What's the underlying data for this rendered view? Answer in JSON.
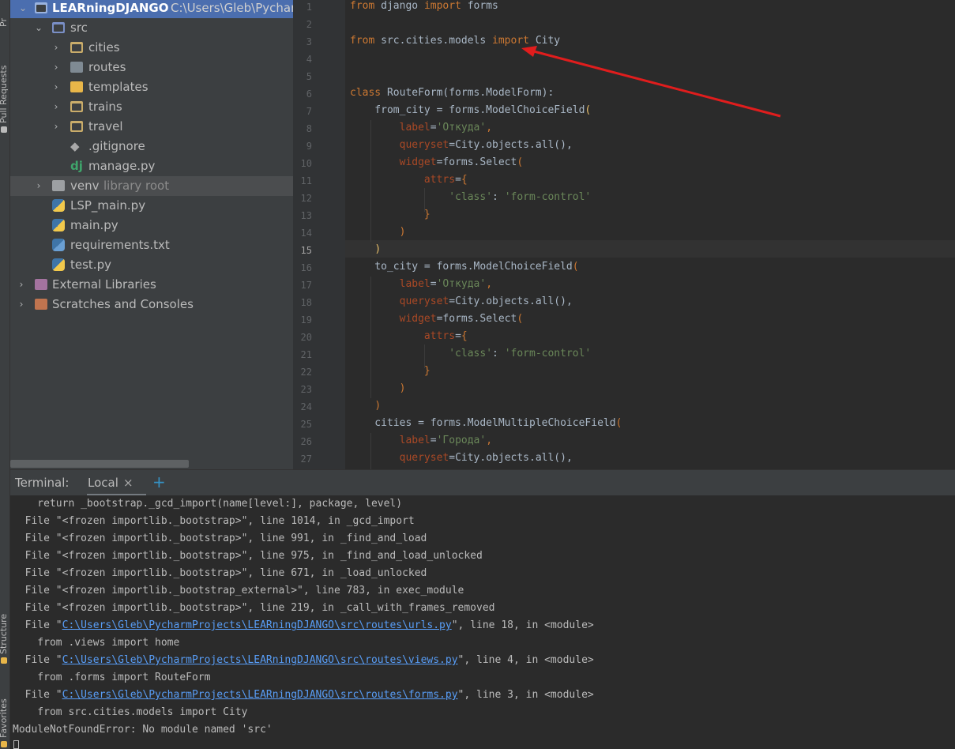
{
  "tool_strip": {
    "top_tab": "Pr",
    "pull_requests_tab": "Pull Requests",
    "structure_tab": "Structure",
    "favorites_tab": "Favorites"
  },
  "project_tree": {
    "root": {
      "name": "LEARningDJANGO",
      "path": "C:\\Users\\Gleb\\Pycharm"
    },
    "items": [
      {
        "label": "src",
        "sub": ""
      },
      {
        "label": "cities",
        "sub": ""
      },
      {
        "label": "routes",
        "sub": ""
      },
      {
        "label": "templates",
        "sub": ""
      },
      {
        "label": "trains",
        "sub": ""
      },
      {
        "label": "travel",
        "sub": ""
      },
      {
        "label": ".gitignore",
        "sub": ""
      },
      {
        "label": "manage.py",
        "sub": ""
      },
      {
        "label": "venv",
        "sub": "library root"
      },
      {
        "label": "LSP_main.py",
        "sub": ""
      },
      {
        "label": "main.py",
        "sub": ""
      },
      {
        "label": "requirements.txt",
        "sub": ""
      },
      {
        "label": "test.py",
        "sub": ""
      },
      {
        "label": "External Libraries",
        "sub": ""
      },
      {
        "label": "Scratches and Consoles",
        "sub": ""
      }
    ]
  },
  "editor": {
    "current_line": 15,
    "line_numbers": [
      "1",
      "2",
      "3",
      "4",
      "5",
      "6",
      "7",
      "8",
      "9",
      "10",
      "11",
      "12",
      "13",
      "14",
      "15",
      "16",
      "17",
      "18",
      "19",
      "20",
      "21",
      "22",
      "23",
      "24",
      "25",
      "26",
      "27"
    ],
    "code": {
      "l1": [
        "from",
        " django ",
        "import",
        " forms"
      ],
      "l3": [
        "from",
        " src.cities.models ",
        "import",
        " City"
      ],
      "l6": [
        "class",
        " RouteForm(forms.ModelForm):"
      ],
      "l7": [
        "    from_city = forms.ModelChoiceField",
        "("
      ],
      "l8": [
        "        ",
        "label",
        "=",
        "'Откуда'",
        ","
      ],
      "l9": [
        "        ",
        "queryset",
        "=City.objects.all(),"
      ],
      "l10": [
        "        ",
        "widget",
        "=forms.Select",
        "("
      ],
      "l11": [
        "            ",
        "attrs",
        "=",
        "{"
      ],
      "l12": [
        "                ",
        "'class'",
        ": ",
        "'form-control'"
      ],
      "l13": [
        "            ",
        "}"
      ],
      "l14": [
        "        ",
        ")"
      ],
      "l15": [
        "    ",
        ")"
      ],
      "l16": [
        "    to_city = forms.ModelChoiceField",
        "("
      ],
      "l17": [
        "        ",
        "label",
        "=",
        "'Откуда'",
        ","
      ],
      "l18": [
        "        ",
        "queryset",
        "=City.objects.all(),"
      ],
      "l19": [
        "        ",
        "widget",
        "=forms.Select",
        "("
      ],
      "l20": [
        "            ",
        "attrs",
        "=",
        "{"
      ],
      "l21": [
        "                ",
        "'class'",
        ": ",
        "'form-control'"
      ],
      "l22": [
        "            ",
        "}"
      ],
      "l23": [
        "        ",
        ")"
      ],
      "l24": [
        "    ",
        ")"
      ],
      "l25": [
        "    cities = forms.ModelMultipleChoiceField",
        "("
      ],
      "l26": [
        "        ",
        "label",
        "=",
        "'Города'",
        ","
      ],
      "l27": [
        "        ",
        "queryset",
        "=City.objects.all(),"
      ]
    }
  },
  "terminal": {
    "title": "Terminal:",
    "tab_label": "Local",
    "close_glyph": "×",
    "add_glyph": "+",
    "lines": [
      "    return _bootstrap._gcd_import(name[level:], package, level)",
      "  File \"<frozen importlib._bootstrap>\", line 1014, in _gcd_import",
      "  File \"<frozen importlib._bootstrap>\", line 991, in _find_and_load",
      "  File \"<frozen importlib._bootstrap>\", line 975, in _find_and_load_unlocked",
      "  File \"<frozen importlib._bootstrap>\", line 671, in _load_unlocked",
      "  File \"<frozen importlib._bootstrap_external>\", line 783, in exec_module",
      "  File \"<frozen importlib._bootstrap>\", line 219, in _call_with_frames_removed"
    ],
    "link_lines": [
      {
        "pre": "  File \"",
        "link": "C:\\Users\\Gleb\\PycharmProjects\\LEARningDJANGO\\src\\routes\\urls.py",
        "post": "\", line 18, in <module>"
      },
      {
        "text": "    from .views import home"
      },
      {
        "pre": "  File \"",
        "link": "C:\\Users\\Gleb\\PycharmProjects\\LEARningDJANGO\\src\\routes\\views.py",
        "post": "\", line 4, in <module>"
      },
      {
        "text": "    from .forms import RouteForm"
      },
      {
        "pre": "  File \"",
        "link": "C:\\Users\\Gleb\\PycharmProjects\\LEARningDJANGO\\src\\routes\\forms.py",
        "post": "\", line 3, in <module>"
      },
      {
        "text": "    from src.cities.models import City"
      }
    ],
    "error": "ModuleNotFoundError: No module named 'src'"
  }
}
